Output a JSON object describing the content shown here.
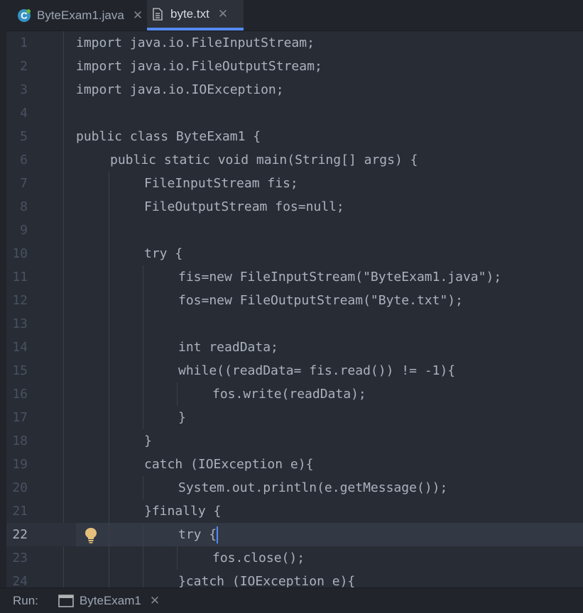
{
  "tabs": [
    {
      "label": "ByteExam1.java",
      "active": false,
      "icon": "java-class-icon"
    },
    {
      "label": "byte.txt",
      "active": true,
      "icon": "text-file-icon"
    }
  ],
  "close_glyph": "✕",
  "current_line": 22,
  "lines": [
    {
      "n": "1",
      "indent": 0,
      "text": "import java.io.FileInputStream;"
    },
    {
      "n": "2",
      "indent": 0,
      "text": "import java.io.FileOutputStream;"
    },
    {
      "n": "3",
      "indent": 0,
      "text": "import java.io.IOException;"
    },
    {
      "n": "4",
      "indent": 0,
      "text": ""
    },
    {
      "n": "5",
      "indent": 0,
      "text": "public class ByteExam1 {"
    },
    {
      "n": "6",
      "indent": 1,
      "text": "public static void main(String[] args) {"
    },
    {
      "n": "7",
      "indent": 2,
      "text": "FileInputStream fis;"
    },
    {
      "n": "8",
      "indent": 2,
      "text": "FileOutputStream fos=null;"
    },
    {
      "n": "9",
      "indent": 0,
      "text": ""
    },
    {
      "n": "10",
      "indent": 2,
      "text": "try {"
    },
    {
      "n": "11",
      "indent": 3,
      "text": "fis=new FileInputStream(\"ByteExam1.java\");"
    },
    {
      "n": "12",
      "indent": 3,
      "text": "fos=new FileOutputStream(\"Byte.txt\");"
    },
    {
      "n": "13",
      "indent": 0,
      "text": ""
    },
    {
      "n": "14",
      "indent": 3,
      "text": "int readData;"
    },
    {
      "n": "15",
      "indent": 3,
      "text": "while((readData= fis.read()) != -1){"
    },
    {
      "n": "16",
      "indent": 4,
      "text": "fos.write(readData);"
    },
    {
      "n": "17",
      "indent": 3,
      "text": "}"
    },
    {
      "n": "18",
      "indent": 2,
      "text": "}"
    },
    {
      "n": "19",
      "indent": 2,
      "text": "catch (IOException e){"
    },
    {
      "n": "20",
      "indent": 3,
      "text": "System.out.println(e.getMessage());"
    },
    {
      "n": "21",
      "indent": 2,
      "text": "}finally {"
    },
    {
      "n": "22",
      "indent": 3,
      "text": "try {"
    },
    {
      "n": "23",
      "indent": 4,
      "text": "fos.close();"
    },
    {
      "n": "24",
      "indent": 3,
      "text": "}catch (IOException e){"
    }
  ],
  "runbar": {
    "label": "Run:",
    "config": "ByteExam1",
    "icon": "run-console-icon"
  },
  "colors": {
    "background": "#282c34",
    "text": "#abb2bf",
    "line_number": "#495162",
    "accent": "#568af2",
    "bulb": "#e5c07b",
    "java_icon": "#3592c4"
  }
}
